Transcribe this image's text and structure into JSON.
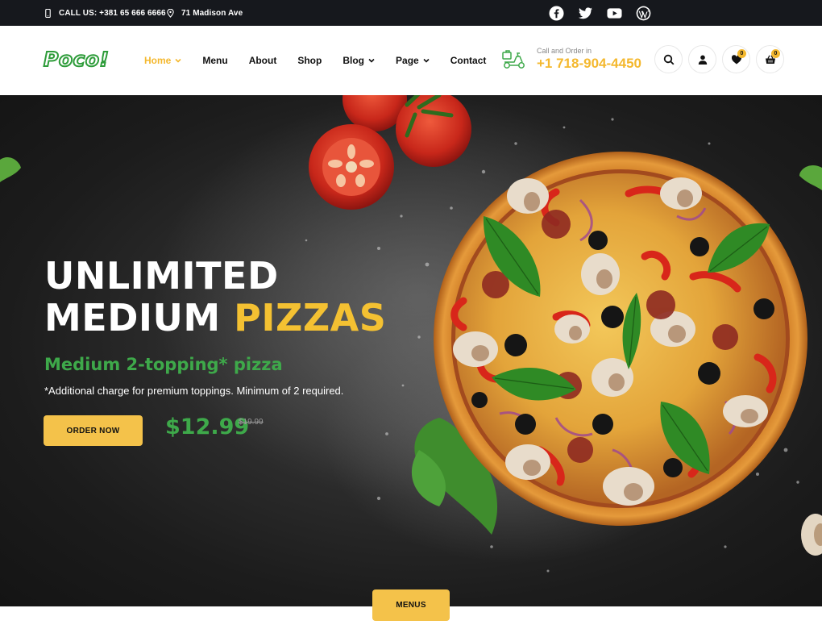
{
  "topbar": {
    "call": "CALL US: +381 65 666 6666",
    "address": "71 Madison Ave",
    "socials": [
      "facebook-icon",
      "twitter-icon",
      "youtube-icon",
      "wordpress-icon"
    ]
  },
  "header": {
    "logo": "Poco!",
    "nav": [
      {
        "label": "Home",
        "active": true,
        "dropdown": true
      },
      {
        "label": "Menu",
        "active": false,
        "dropdown": false
      },
      {
        "label": "About",
        "active": false,
        "dropdown": false
      },
      {
        "label": "Shop",
        "active": false,
        "dropdown": false
      },
      {
        "label": "Blog",
        "active": false,
        "dropdown": true
      },
      {
        "label": "Page",
        "active": false,
        "dropdown": true
      },
      {
        "label": "Contact",
        "active": false,
        "dropdown": false
      }
    ],
    "order_label": "Call and Order in",
    "order_phone": "+1 718-904-4450",
    "wishlist_count": "0",
    "cart_count": "0"
  },
  "hero": {
    "line1": "UNLIMITED",
    "line2_white": "MEDIUM",
    "line2_accent": "PIZZAS",
    "subtitle": "Medium 2-topping* pizza",
    "note": "*Additional charge for premium toppings. Minimum of 2 required.",
    "button": "ORDER NOW",
    "price": "$12.99",
    "old_price": "$19.99"
  },
  "menus_tab": "MENUS",
  "colors": {
    "accent_yellow": "#f4c24a",
    "brand_green": "#3ea94a",
    "topbar_bg": "#16181d"
  }
}
